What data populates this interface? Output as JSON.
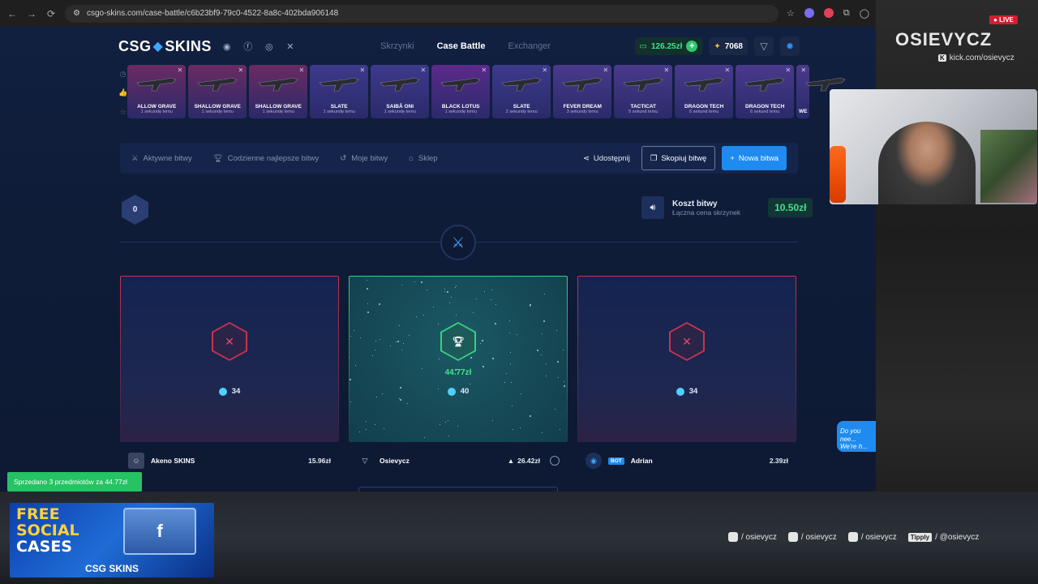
{
  "browser": {
    "url": "csgo-skins.com/case-battle/c6b23bf9-79c0-4522-8a8c-402bda906148"
  },
  "site": {
    "logo_left": "CSG",
    "logo_right": "SKINS",
    "menu": [
      "Skrzynki",
      "Case Battle",
      "Exchanger"
    ],
    "active_menu": "Case Battle",
    "balance": "126.25zł",
    "coins": "7068"
  },
  "drops": [
    {
      "name": "ALLOW GRAVE",
      "time": "1 sekundę temu",
      "color": "#6b2a63"
    },
    {
      "name": "SHALLOW GRAVE",
      "time": "1 sekundę temu",
      "color": "#6b2a63"
    },
    {
      "name": "SHALLOW GRAVE",
      "time": "1 sekundę temu",
      "color": "#6b2a63"
    },
    {
      "name": "SLATE",
      "time": "1 sekundę temu",
      "color": "#3d3a8c"
    },
    {
      "name": "SAIBĀ ONI",
      "time": "1 sekundę temu",
      "color": "#3d3a8c"
    },
    {
      "name": "BLACK LOTUS",
      "time": "1 sekundę temu",
      "color": "#5b2a8c"
    },
    {
      "name": "SLATE",
      "time": "2 sekundy temu",
      "color": "#3d3a8c"
    },
    {
      "name": "FEVER DREAM",
      "time": "3 sekundy temu",
      "color": "#4a3a8c"
    },
    {
      "name": "TACTICAT",
      "time": "5 sekund temu",
      "color": "#4a3a8c"
    },
    {
      "name": "DRAGON TECH",
      "time": "6 sekund temu",
      "color": "#4a3a8c"
    },
    {
      "name": "DRAGON TECH",
      "time": "6 sekund temu",
      "color": "#4a3a8c"
    },
    {
      "name": "WE",
      "time": "",
      "color": "#4a3a8c"
    }
  ],
  "tabs": {
    "active_battles": "Aktywne bitwy",
    "daily_best": "Codzienne najlepsze bitwy",
    "my_battles": "Moje bitwy",
    "shop": "Sklep",
    "share": "Udostępnij",
    "copy": "Skopiuj bitwę",
    "new": "Nowa bitwa"
  },
  "battle": {
    "round": "0",
    "cost_title": "Koszt bitwy",
    "cost_subtitle": "Łączna cena skrzynek",
    "cost_value": "10.50zł"
  },
  "players": [
    {
      "name": "Akeno SKINS",
      "value": "15.96zł",
      "count": "34",
      "state": "lose",
      "bot": false
    },
    {
      "name": "Osievycz",
      "value": "26.42zł",
      "count": "40",
      "state": "win",
      "prize": "44.77zł",
      "bot": false
    },
    {
      "name": "Adrian",
      "value": "2.39zł",
      "count": "34",
      "state": "lose",
      "bot": true,
      "bot_label": "BOT"
    }
  ],
  "chat_bubble": "Do you nee... We're h...",
  "overlay": {
    "toast": "Sprzedano 3 przedmiotów za 44.77zł",
    "promo_line1": "FREE",
    "promo_line2": "SOCIAL",
    "promo_line3": "CASES",
    "promo_brand": "CSG SKINS",
    "streamer": "OSIEVYCZ",
    "kick_url": "kick.com/osievycz",
    "live": "LIVE",
    "socials": [
      "/ osievycz",
      "/ osievycz",
      "/ osievycz",
      "/ @osievycz"
    ],
    "tipply": "Tipply"
  }
}
